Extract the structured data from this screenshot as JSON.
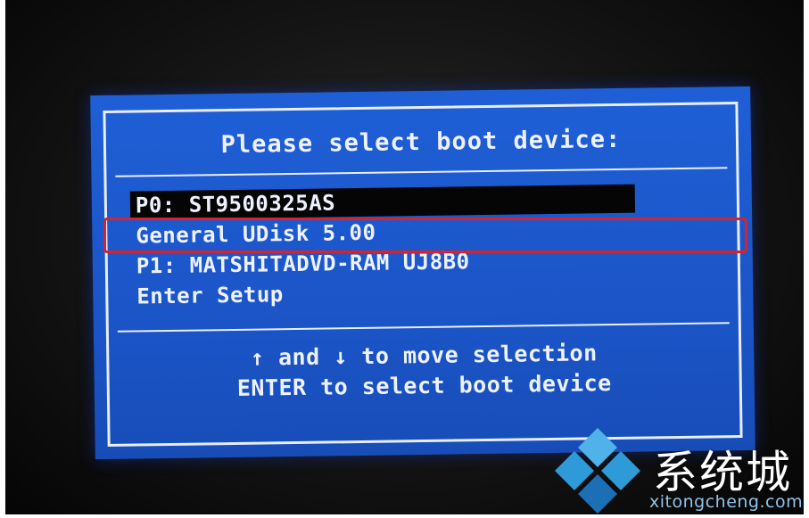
{
  "boot_menu": {
    "title": "Please select boot device:",
    "items": [
      {
        "label": "P0: ST9500325AS",
        "selected": true
      },
      {
        "label": "General UDisk 5.00",
        "selected": false,
        "highlighted": true
      },
      {
        "label": "P1: MATSHITADVD-RAM UJ8B0",
        "selected": false
      },
      {
        "label": "Enter Setup",
        "selected": false
      }
    ],
    "help_line1": "↑ and ↓ to move selection",
    "help_line2": "ENTER to select boot device"
  },
  "watermark": {
    "brand": "系统城",
    "domain": "xitongcheng.com",
    "colors": {
      "accent": "#2e9bd8",
      "dark": "#1b6fb5"
    }
  },
  "colors": {
    "bios_blue": "#1b55c8",
    "bios_text": "#eef2ff",
    "selection_bg": "#050505",
    "annotation_red": "#d8232b"
  }
}
